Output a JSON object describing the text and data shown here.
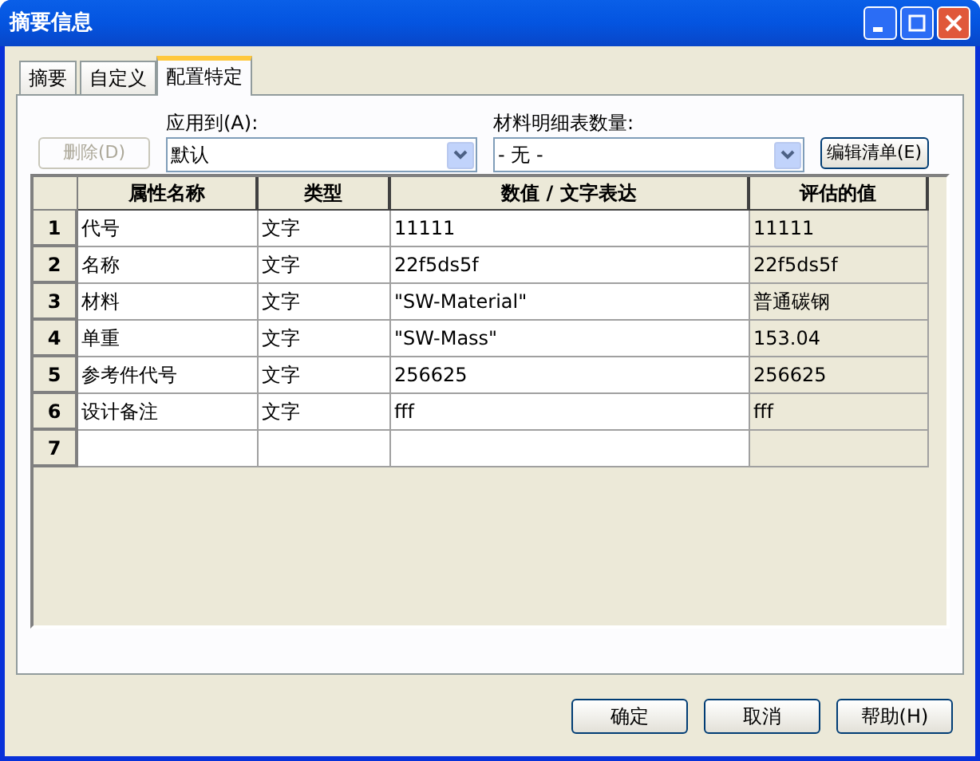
{
  "window": {
    "title": "摘要信息"
  },
  "tabs": [
    {
      "label": "摘要",
      "selected": false
    },
    {
      "label": "自定义",
      "selected": false
    },
    {
      "label": "配置特定",
      "selected": true
    }
  ],
  "delete_button": {
    "label": "删除(D)",
    "disabled": true
  },
  "apply_to": {
    "label": "应用到(A):",
    "value": "默认"
  },
  "bom_quantity": {
    "label": "材料明细表数量:",
    "value": "- 无 -"
  },
  "edit_list_button": {
    "label": "编辑清单(E)"
  },
  "table": {
    "columns": [
      "属性名称",
      "类型",
      "数值 / 文字表达",
      "评估的值"
    ],
    "rows": [
      {
        "index": "1",
        "cells": [
          "代号",
          "文字",
          "11111",
          "11111"
        ]
      },
      {
        "index": "2",
        "cells": [
          "名称",
          "文字",
          "22f5ds5f",
          "22f5ds5f"
        ]
      },
      {
        "index": "3",
        "cells": [
          "材料",
          "文字",
          "\"SW-Material\"",
          "普通碳钢"
        ]
      },
      {
        "index": "4",
        "cells": [
          "单重",
          "文字",
          "\"SW-Mass\"",
          "153.04"
        ]
      },
      {
        "index": "5",
        "cells": [
          "参考件代号",
          "文字",
          "256625",
          "256625"
        ]
      },
      {
        "index": "6",
        "cells": [
          "设计备注",
          "文字",
          "fff",
          "fff"
        ]
      },
      {
        "index": "7",
        "cells": []
      }
    ]
  },
  "buttons": [
    "确定",
    "取消",
    "帮助(H)"
  ]
}
